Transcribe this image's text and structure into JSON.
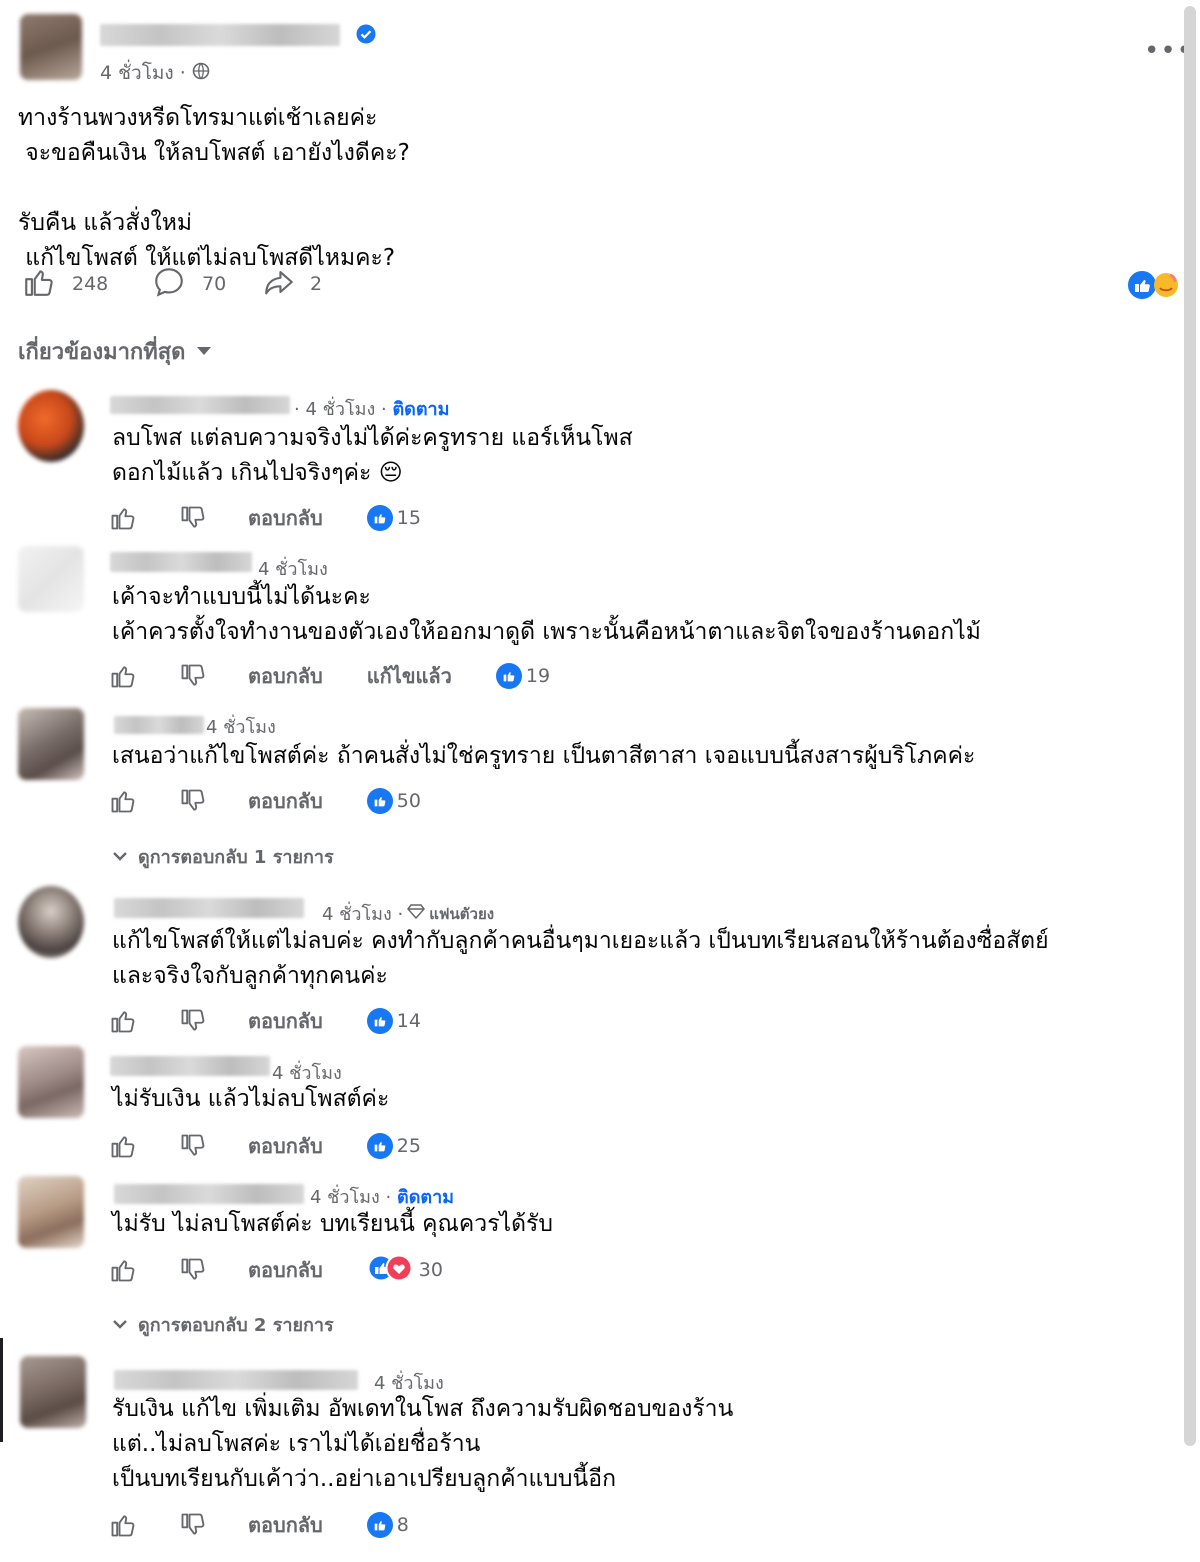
{
  "post": {
    "time": "4 ชั่วโมง ·",
    "body": "ทางร้านพวงหรีดโทรมาแต่เช้าเลยค่ะ\n จะขอคืนเงิน ให้ลบโพสต์ เอายังไงดีคะ?\n\nรับคืน แล้วสั่งใหม่\n แก้ไขโพสต์ ให้แต่ไม่ลบโพสดีไหมคะ?",
    "likes": "248",
    "comments": "70",
    "shares": "2"
  },
  "sort_label": "เกี่ยวข้องมากที่สุด",
  "common": {
    "reply_label": "ตอบกลับ",
    "edited_label": "แก้ไขแล้ว",
    "follow_label": "ติดตาม",
    "top_fan_label": "แฟนตัวยง"
  },
  "comments": [
    {
      "time": "· 4 ชั่วโมง ·",
      "text": "ลบโพส แต่ลบความจริงไม่ได้ค่ะครูทราย แอร์เห็นโพส\nดอกไม้แล้ว เกินไปจริงๆค่ะ 😔",
      "reactions": "15"
    },
    {
      "time": "4 ชั่วโมง",
      "text": "เค้าจะทำแบบนี้ไม่ได้นะคะ\nเค้าควรตั้งใจทำงานของตัวเองให้ออกมาดูดี เพราะนั้นคือหน้าตาและจิตใจของร้านดอกไม้",
      "reactions": "19"
    },
    {
      "time": "4 ชั่วโมง",
      "text": "เสนอว่าแก้ไขโพสต์ค่ะ ถ้าคนสั่งไม่ใช่ครูทราย เป็นตาสีตาสา เจอแบบนี้สงสารผู้บริโภคค่ะ",
      "reactions": "50",
      "view_replies": "ดูการตอบกลับ 1 รายการ"
    },
    {
      "time": "4 ชั่วโมง ·",
      "text": "แก้ไขโพสต์ให้แต่ไม่ลบค่ะ คงทำกับลูกค้าคนอื่นๆมาเยอะแล้ว เป็นบทเรียนสอนให้ร้านต้องซื่อสัตย์\nและจริงใจกับลูกค้าทุกคนค่ะ",
      "reactions": "14"
    },
    {
      "time": "4 ชั่วโมง",
      "text": "ไม่รับเงิน แล้วไม่ลบโพสต์ค่ะ",
      "reactions": "25"
    },
    {
      "time": "4 ชั่วโมง ·",
      "text": "ไม่รับ ไม่ลบโพสต์ค่ะ บทเรียนนี้ คุณควรได้รับ",
      "reactions": "30",
      "view_replies": "ดูการตอบกลับ 2 รายการ"
    },
    {
      "time": "4 ชั่วโมง",
      "text": "รับเงิน แก้ไข เพิ่มเติม อัพเดทในโพส ถึงความรับผิดชอบของร้าน\nแต่..ไม่ลบโพสค่ะ เราไม่ได้เอ่ยชื่อร้าน\nเป็นบทเรียนกับเค้าว่า..อย่าเอาเปรียบลูกค้าแบบนี้อีก",
      "reactions": "8"
    }
  ],
  "colors": {
    "accent": "#1877f2",
    "verified": "#1877f2",
    "love": "#f33e58"
  }
}
